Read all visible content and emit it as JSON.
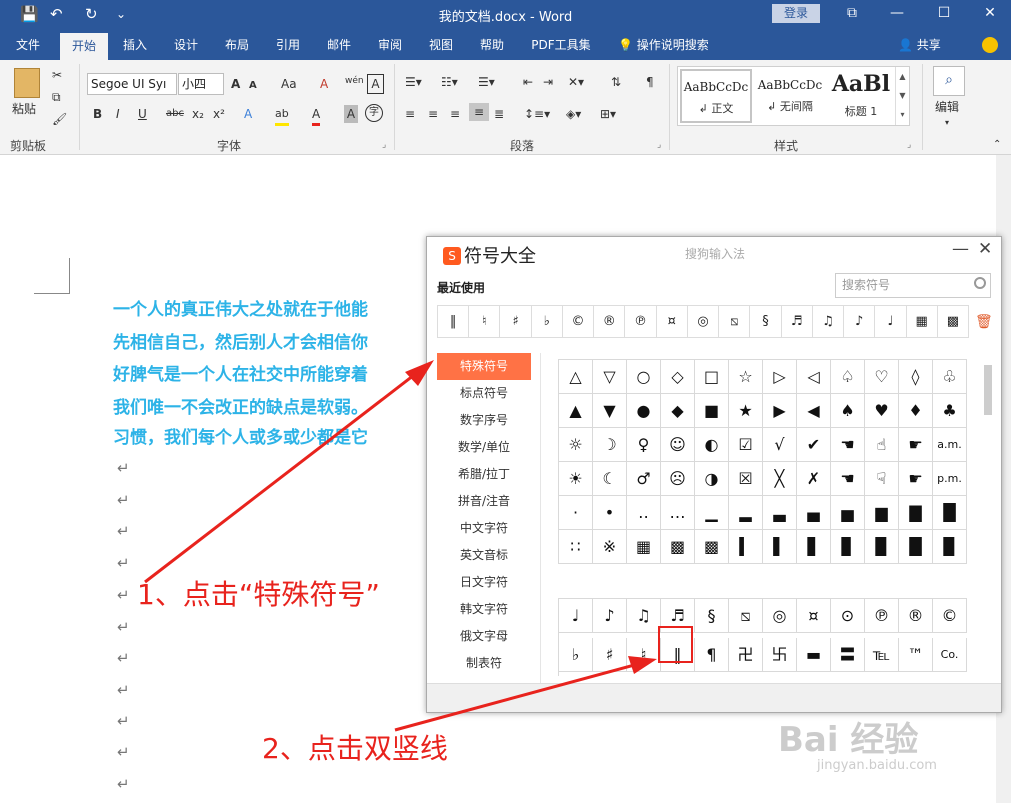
{
  "titlebar": {
    "doc_title": "我的文档.docx - Word",
    "login": "登录",
    "save_icon": "💾",
    "undo_icon": "↶",
    "redo_icon": "↻",
    "qa_more": "⌄",
    "min": "—",
    "max": "☐",
    "close": "✕",
    "restore": "⧉"
  },
  "tabs": [
    "文件",
    "开始",
    "插入",
    "设计",
    "布局",
    "引用",
    "邮件",
    "审阅",
    "视图",
    "帮助",
    "PDF工具集"
  ],
  "tell_me": "操作说明搜索",
  "share": "共享",
  "ribbon": {
    "clipboard": {
      "paste": "粘贴",
      "label": "剪贴板"
    },
    "font": {
      "name": "Segoe UI Syı",
      "size": "小四",
      "label": "字体",
      "grow": "A",
      "shrink": "A",
      "case": "Aa",
      "clear": "A",
      "pinyin": "wén",
      "border_char": "A",
      "bold": "B",
      "italic": "I",
      "underline": "U",
      "strike": "abc",
      "sub": "x₂",
      "sup": "x²",
      "effect": "A",
      "highlight": "ab",
      "color": "A",
      "shade": "A",
      "circle": "字"
    },
    "paragraph": {
      "label": "段落"
    },
    "styles": {
      "label": "样式",
      "items": [
        {
          "preview": "AaBbCcDc",
          "name": "↲ 正文"
        },
        {
          "preview": "AaBbCcDc",
          "name": "↲ 无间隔"
        },
        {
          "preview": "AaBl",
          "name": "标题 1"
        }
      ]
    },
    "editing": {
      "label": "编辑"
    }
  },
  "document": {
    "paragraph_lines": [
      "一个人的真正伟大之处就在于他能",
      "先相信自己，然后别人才会相信你",
      "好脾气是一个人在社交中所能穿着",
      "我们唯一不会改正的缺点是软弱。",
      "习惯，我们每个人或多或少都是它"
    ],
    "return_mark": "↵"
  },
  "dialog": {
    "logo": "S",
    "title": "符号大全",
    "ime": "搜狗输入法",
    "minimize": "—",
    "close": "✕",
    "recent_label": "最近使用",
    "search_placeholder": "搜索符号",
    "recent": [
      "‖",
      "♮",
      "♯",
      "♭",
      "©",
      "®",
      "℗",
      "¤",
      "◎",
      "⧅",
      "§",
      "♬",
      "♫",
      "♪",
      "♩",
      "▦",
      "▩"
    ],
    "categories": [
      "特殊符号",
      "标点符号",
      "数字序号",
      "数学/单位",
      "希腊/拉丁",
      "拼音/注音",
      "中文字符",
      "英文音标",
      "日文字符",
      "韩文字符",
      "俄文字母",
      "制表符"
    ],
    "grid1": [
      "△",
      "▽",
      "○",
      "◇",
      "□",
      "☆",
      "▷",
      "◁",
      "♤",
      "♡",
      "◊",
      "♧",
      "▲",
      "▼",
      "●",
      "◆",
      "■",
      "★",
      "▶",
      "◀",
      "♠",
      "♥",
      "♦",
      "♣",
      "☼",
      "☽",
      "♀",
      "☺",
      "◐",
      "☑",
      "√",
      "✔",
      "☚",
      "☝",
      "☛",
      "a.m.",
      "☀",
      "☾",
      "♂",
      "☹",
      "◑",
      "☒",
      "╳",
      "✗",
      "☚",
      "☟",
      "☛",
      "p.m.",
      "·",
      "•",
      "‥",
      "…",
      "▁",
      "▂",
      "▃",
      "▄",
      "▅",
      "▆",
      "▇",
      "█",
      "∷",
      "※",
      "▦",
      "▩",
      "▩",
      "▍",
      "▌",
      "▋",
      "▊",
      "▉",
      "█",
      "▉"
    ],
    "grid2": [
      "♩",
      "♪",
      "♫",
      "♬",
      "§",
      "⧅",
      "◎",
      "¤",
      "⊙",
      "℗",
      "®",
      "©",
      "♭",
      "♯",
      "♮",
      "‖",
      "¶",
      "卍",
      "卐",
      "▬",
      "〓",
      "℡",
      "™",
      "Co."
    ]
  },
  "annotations": {
    "step1": "1、点击“特殊符号”",
    "step2": "2、点击双竖线"
  },
  "watermark": {
    "main": "Bai 经验",
    "sub": "jingyan.baidu.com"
  },
  "colors": {
    "word_blue": "#2b579a",
    "accent_orange": "#ff7245",
    "annotation_red": "#e8231d",
    "text_cyan": "#2db3e7"
  }
}
